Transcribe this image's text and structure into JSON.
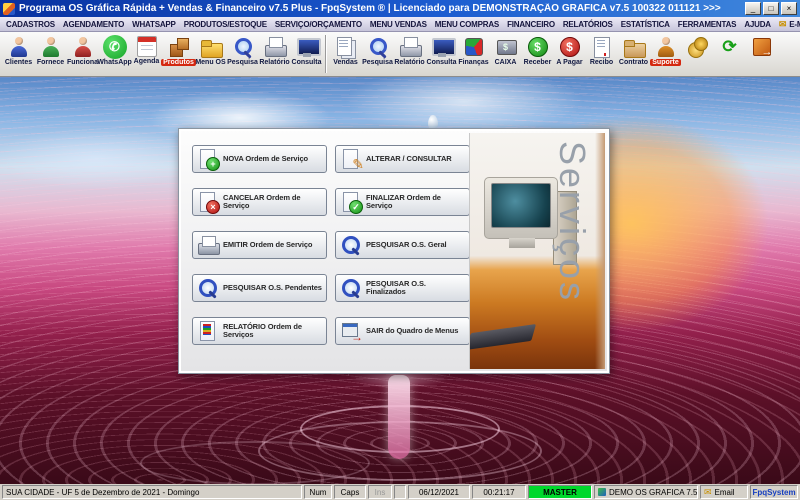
{
  "window": {
    "title": "Programa OS Gráfica Rápida + Vendas & Financeiro v7.5 Plus - FpqSystem ® | Licenciado para  DEMONSTRAÇÃO GRAFICA v7.5 100322 011121 >>>",
    "controls": {
      "minimize": "_",
      "maximize": "□",
      "close": "×"
    }
  },
  "menubar": {
    "items": [
      {
        "id": "cadastros",
        "label": "CADASTROS"
      },
      {
        "id": "agendamento",
        "label": "AGENDAMENTO"
      },
      {
        "id": "whatsapp",
        "label": "WHATSAPP"
      },
      {
        "id": "produtos-estoque",
        "label": "PRODUTOS/ESTOQUE"
      },
      {
        "id": "servico-orcamento",
        "label": "SERVIÇO/ORÇAMENTO"
      },
      {
        "id": "menu-vendas",
        "label": "MENU VENDAS"
      },
      {
        "id": "menu-compras",
        "label": "MENU COMPRAS"
      },
      {
        "id": "financeiro",
        "label": "FINANCEIRO"
      },
      {
        "id": "relatorios",
        "label": "RELATÓRIOS"
      },
      {
        "id": "estatistica",
        "label": "ESTATÍSTICA"
      },
      {
        "id": "ferramentas",
        "label": "FERRAMENTAS"
      },
      {
        "id": "ajuda",
        "label": "AJUDA"
      },
      {
        "id": "email",
        "label": "E-MAIL",
        "icon": "email-icon"
      }
    ]
  },
  "toolbar": {
    "buttons": [
      {
        "id": "clientes",
        "label": "Clientes",
        "icon": "clients-icon"
      },
      {
        "id": "fornece",
        "label": "Fornece",
        "icon": "supplier-icon"
      },
      {
        "id": "funciona",
        "label": "Funciona",
        "icon": "employee-icon"
      },
      {
        "id": "whatsapp",
        "label": "WhatsApp",
        "icon": "whatsapp-icon"
      },
      {
        "id": "agenda",
        "label": "Agenda",
        "icon": "calendar-icon"
      },
      {
        "id": "produtos",
        "label": "Produtos",
        "icon": "products-icon",
        "badge": true
      },
      {
        "id": "menuos",
        "label": "Menu OS",
        "icon": "service-order-folder-icon"
      },
      {
        "id": "pesquisa1",
        "label": "Pesquisa",
        "icon": "search-icon"
      },
      {
        "id": "relatorio1",
        "label": "Relatório",
        "icon": "printer-report-icon"
      },
      {
        "id": "consulta1",
        "label": "Consulta",
        "icon": "monitor-consult-icon"
      },
      {
        "separator": true
      },
      {
        "id": "vendas",
        "label": "Vendas",
        "icon": "sales-documents-icon"
      },
      {
        "id": "pesquisa2",
        "label": "Pesquisa",
        "icon": "search-icon"
      },
      {
        "id": "relatorio2",
        "label": "Relatório",
        "icon": "printer-report-icon"
      },
      {
        "id": "consulta2",
        "label": "Consulta",
        "icon": "monitor-consult-icon"
      },
      {
        "id": "financas",
        "label": "Finanças",
        "icon": "finance-cube-icon"
      },
      {
        "id": "caixa",
        "label": "CAIXA",
        "icon": "cash-register-icon"
      },
      {
        "id": "receber",
        "label": "Receber",
        "icon": "receivables-coin-icon"
      },
      {
        "id": "apagar",
        "label": "A Pagar",
        "icon": "payables-coin-icon"
      },
      {
        "id": "recibo",
        "label": "Recibo",
        "icon": "receipt-icon"
      },
      {
        "id": "contrato",
        "label": "Contrato",
        "icon": "contract-folder-icon"
      },
      {
        "id": "suporte",
        "label": "Suporte",
        "icon": "support-icon",
        "badge": true
      },
      {
        "id": "moedas",
        "label": "",
        "icon": "coins-icon"
      },
      {
        "id": "sync",
        "label": "",
        "icon": "refresh-icon"
      },
      {
        "id": "sistema",
        "label": "",
        "icon": "exit-box-icon"
      }
    ]
  },
  "dialog": {
    "side_label": "Serviços",
    "buttons": [
      {
        "id": "nova",
        "label": "NOVA Ordem de Serviço",
        "icon": "new-order-icon"
      },
      {
        "id": "alterar",
        "label": "ALTERAR / CONSULTAR",
        "icon": "edit-order-icon"
      },
      {
        "id": "cancelar",
        "label": "CANCELAR Ordem de Serviço",
        "icon": "cancel-order-icon"
      },
      {
        "id": "finalizar",
        "label": "FINALIZAR Ordem de Serviço",
        "icon": "finalize-order-icon"
      },
      {
        "id": "emitir",
        "label": "EMITIR Ordem de Serviço",
        "icon": "print-order-icon"
      },
      {
        "id": "pesq-geral",
        "label": "PESQUISAR O.S. Geral",
        "icon": "search-icon"
      },
      {
        "id": "pesq-pend",
        "label": "PESQUISAR O.S. Pendentes",
        "icon": "search-icon"
      },
      {
        "id": "pesq-fin",
        "label": "PESQUISAR O.S. Finalizados",
        "icon": "search-icon"
      },
      {
        "id": "relatorio",
        "label": "RELATÓRIO Ordem de Serviços",
        "icon": "report-icon"
      },
      {
        "id": "sair",
        "label": "SAIR do Quadro de Menus",
        "icon": "exit-icon"
      }
    ]
  },
  "statusbar": {
    "location": "SUA CIDADE - UF   5 de Dezembro de 2021 - Domingo",
    "num": "Num",
    "caps": "Caps",
    "ins": "Ins",
    "date": "06/12/2021",
    "time": "00:21:17",
    "user": "MASTER",
    "demo": "DEMO OS GRAFICA 7.5",
    "email": "Email",
    "brand": "FpqSystem"
  },
  "colors": {
    "title_bar_blue": "#1c5cd0",
    "toolbar_badge_red": "#d42810",
    "master_green": "#00d82c",
    "brand_blue": "#1840c0",
    "desk_orange": "#cc7a22"
  }
}
